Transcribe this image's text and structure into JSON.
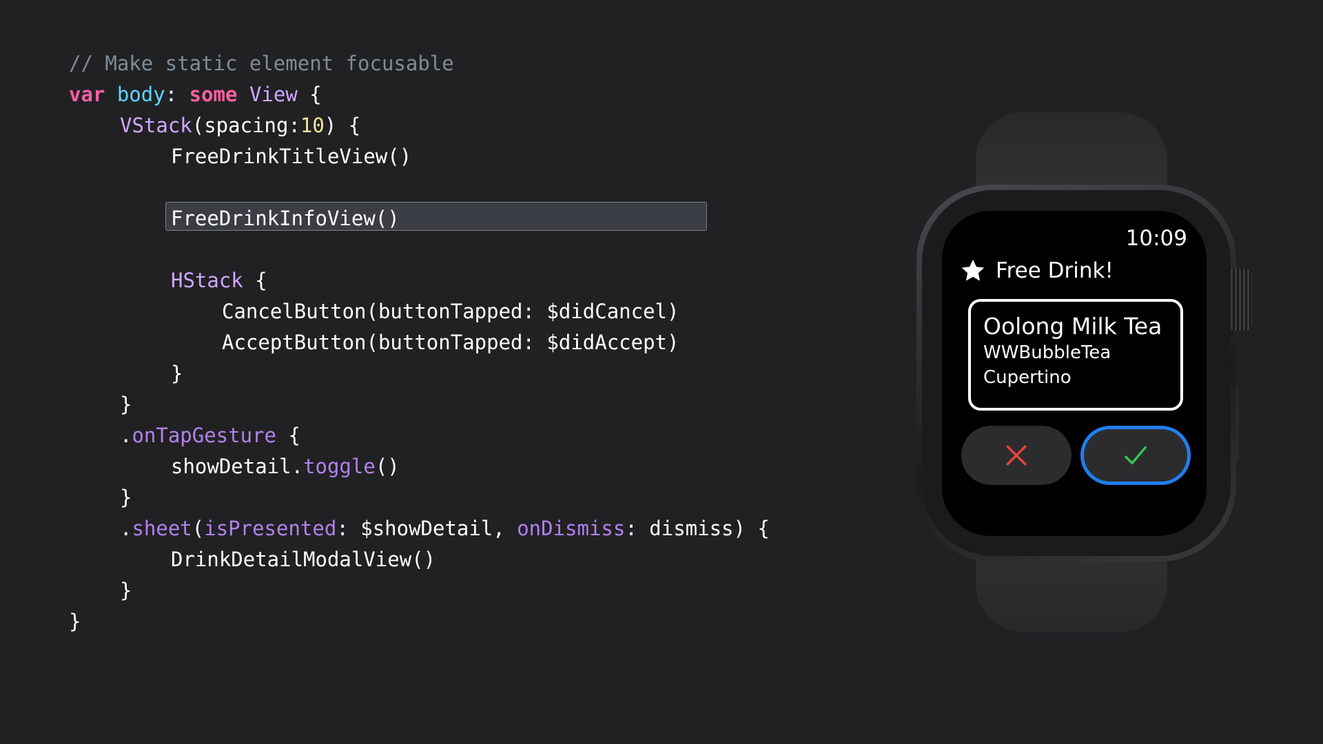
{
  "code": {
    "comment": "// Make static element focusable",
    "line2": {
      "kw1": "var",
      "id": "body",
      "p1": ": ",
      "kw2": "some",
      "ty": "View",
      "p2": " {"
    },
    "line3": {
      "ty": "VStack",
      "p1": "(spacing:",
      "num": "10",
      "p2": ") {"
    },
    "line4": "FreeDrinkTitleView()",
    "line5": "FreeDrinkInfoView()",
    "line6": {
      "ty": "HStack",
      "p": " {"
    },
    "line7": "CancelButton(buttonTapped: $didCancel)",
    "line8": "AcceptButton(buttonTapped: $didAccept)",
    "line9": "}",
    "line10": "}",
    "line11": {
      "p1": ".",
      "fn": "onTapGesture",
      "p2": " {"
    },
    "line12": {
      "p1": "showDetail.",
      "fn": "toggle",
      "p2": "()"
    },
    "line13": "}",
    "line14": {
      "p1": ".",
      "fn1": "sheet",
      "p2": "(",
      "fn2": "isPresented",
      "p3": ": $showDetail, ",
      "fn3": "onDismiss",
      "p4": ": dismiss) {"
    },
    "line15": "DrinkDetailModalView()",
    "line16": "}",
    "line17": "}"
  },
  "watch": {
    "time": "10:09",
    "title": "Free Drink!",
    "title_icon": "star-icon",
    "drink_name": "Oolong Milk Tea",
    "shop": "WWBubbleTea",
    "city": "Cupertino",
    "cancel_icon": "x-icon",
    "accept_icon": "checkmark-icon",
    "colors": {
      "cancel": "#e8453c",
      "accept": "#34c759",
      "focus_ring": "#1f7ff0"
    }
  }
}
